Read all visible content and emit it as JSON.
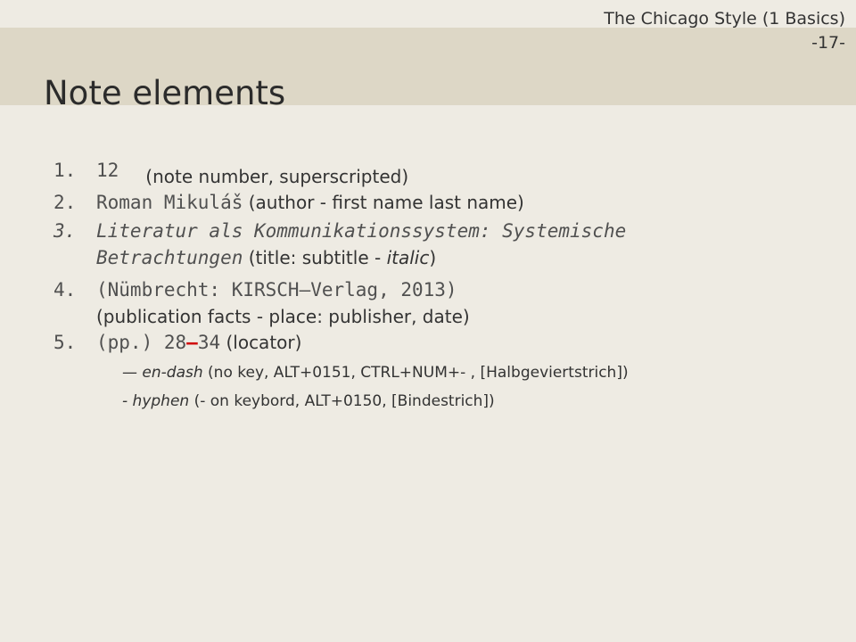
{
  "header": {
    "label_line1": "The Chicago Style (1 Basics)",
    "label_line2": "-17-",
    "title": "Note elements"
  },
  "items": [
    {
      "number": "1.",
      "example": "12",
      "description": "(note number, superscripted)"
    },
    {
      "number": "2.",
      "example": "Roman Mikuláš",
      "description": "(author - first name last name)"
    },
    {
      "number": "3.",
      "example_line1": "Literatur als Kommunikationssystem: Systemische",
      "example_line2": "Betrachtungen",
      "description_pre": "(title: subtitle - ",
      "description_italic": "italic",
      "description_post": ")"
    },
    {
      "number": "4.",
      "example": "(Nümbrecht: KIRSCH–Verlag, 2013)",
      "description": "(publication facts - place: publisher, date)"
    },
    {
      "number": "5.",
      "example_pre": "(pp.) 28",
      "example_dash": "–",
      "example_post": "34",
      "description": "(locator)"
    }
  ],
  "notes": [
    {
      "term": "— en-dash",
      "detail": "(no key, ALT+0151, CTRL+NUM+- , [Halbgeviertstrich])"
    },
    {
      "term": "- hyphen",
      "detail": "(- on keybord, ALT+0150, [Bindestrich])"
    }
  ]
}
